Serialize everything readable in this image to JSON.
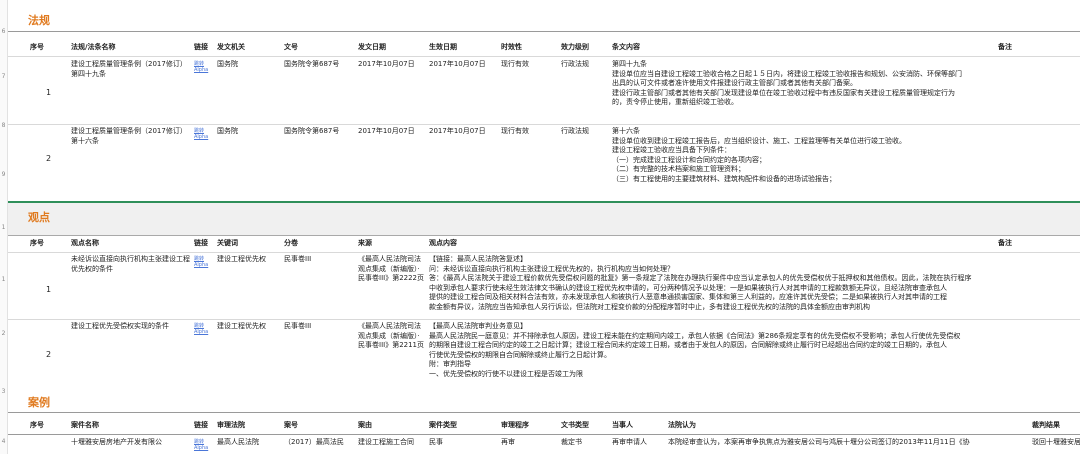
{
  "gutter_rows": [
    "6",
    "7",
    "8",
    "9",
    "1",
    "1",
    "2",
    "3",
    "4"
  ],
  "laws": {
    "title": "法规",
    "headers": {
      "no": "序号",
      "name": "法规/法条名称",
      "link": "链接",
      "org": "发文机关",
      "doc": "文号",
      "issue": "发文日期",
      "effective": "生效日期",
      "timeliness": "时效性",
      "level": "效力级别",
      "content": "条文内容",
      "remark": "备注"
    },
    "rows": [
      {
        "no": "1",
        "name": "建设工程质量管理条例（2017修订）第四十九条",
        "link": "跳转Alpha",
        "org": "国务院",
        "doc": "国务院令第687号",
        "issue": "2017年10月07日",
        "effective": "2017年10月07日",
        "timeliness": "现行有效",
        "level": "行政法规",
        "content": [
          "第四十九条",
          "建设单位应当自建设工程竣工验收合格之日起１５日内，将建设工程竣工验收报告和规划、公安消防、环保等部门",
          "出具的认可文件或者准许使用文件报建设行政主管部门或者其他有关部门备案。",
          "建设行政主管部门或者其他有关部门发现建设单位在竣工验收过程中有违反国家有关建设工程质量管理规定行为",
          "的，责令停止使用，重新组织竣工验收。"
        ]
      },
      {
        "no": "2",
        "name": "建设工程质量管理条例（2017修订）第十六条",
        "link": "跳转Alpha",
        "org": "国务院",
        "doc": "国务院令第687号",
        "issue": "2017年10月07日",
        "effective": "2017年10月07日",
        "timeliness": "现行有效",
        "level": "行政法规",
        "content": [
          "第十六条",
          "建设单位收到建设工程竣工报告后，应当组织设计、施工、工程监理等有关单位进行竣工验收。",
          "建设工程竣工验收应当具备下列条件：",
          "（一）完成建设工程设计和合同约定的各项内容；",
          "（二）有完整的技术档案和施工管理资料；",
          "（三）有工程使用的主要建筑材料、建筑构配件和设备的进场试验报告；"
        ]
      }
    ]
  },
  "views": {
    "title": "观点",
    "headers": {
      "no": "序号",
      "name": "观点名称",
      "link": "链接",
      "keyword": "关键词",
      "category": "分卷",
      "source": "来源",
      "content": "观点内容",
      "remark": "备注"
    },
    "rows": [
      {
        "no": "1",
        "name": "未经诉讼直接向执行机构主张建设工程优先权的条件",
        "link": "跳转Alpha",
        "keyword": "建设工程优先权",
        "category": "民事卷III",
        "source": "《最高人民法院司法观点集成（新编版）·民事卷III》第2222页",
        "content": [
          "【链接：最高人民法院答复述】",
          "问：未经诉讼直接向执行机构主张建设工程优先权的，执行机构应当如何处理？",
          "答：《最高人民法院关于建设工程价款优先受偿权问题的批复》第一条规定了法院在办理执行案件中应当认定承包人的优先受偿权优于抵押权和其他债权。因此，法院在执行程序",
          "中收到承包人要求行使未经生效法律文书确认的建设工程优先权申请的，可分两种情况予以处理：一是如果被执行人对其申请的工程款数额无异议，且经法院审查承包人",
          "提供的建设工程合同及相关材料合法有效，亦未发现承包人和被执行人恶意串通损害国家、集体和第三人利益的，应准许其优先受偿；二是如果被执行人对其申请的工程",
          "款金额有异议，法院应当告知承包人另行诉讼，但法院对工程变价款的分配程序暂时中止，多有建设工程优先权的法院的具体金额应由审判机构"
        ]
      },
      {
        "no": "2",
        "name": "建设工程优先受偿权实现的条件",
        "link": "跳转Alpha",
        "keyword": "建设工程优先权",
        "category": "民事卷III",
        "source": "《最高人民法院司法观点集成（新编版）·民事卷III》第2211页",
        "content": [
          "【最高人民法院审判业务意见】",
          "最高人民法院民一庭意见：并不排除承包人原因，建设工程未能在约定期间内竣工，承包人依据《合同法》第286条规定享有的优先受偿权不受影响；承包人行使优先受偿权",
          "的期限自建设工程合同约定的竣工之日起计算；建设工程合同未约定竣工日期，或者由于发包人的原因，合同解除或终止履行时已经超出合同约定的竣工日期的，承包人",
          "行使优先受偿权的期限自合同解除或终止履行之日起计算。",
          "附：审判指导",
          "一、优先受偿权的行使不以建设工程是否竣工为限"
        ]
      }
    ]
  },
  "cases": {
    "title": "案例",
    "headers": {
      "no": "序号",
      "name": "案件名称",
      "link": "链接",
      "court": "审理法院",
      "caseno": "案号",
      "cause": "案由",
      "casetype": "案件类型",
      "procedure": "审理程序",
      "doctype": "文书类型",
      "party": "当事人",
      "opinion": "法院认为",
      "result": "裁判结果"
    },
    "rows": [
      {
        "no": "1",
        "name": "十堰雅安居房地产开发有限公",
        "link": "跳转Alpha",
        "court": "最高人民法院",
        "caseno": "（2017）最高法民",
        "cause": "建设工程施工合同",
        "casetype": "民事",
        "procedure": "再审",
        "doctype": "裁定书",
        "party": "再审申请人",
        "opinion": "本院经审查认为，本案再审争执焦点为雅安居公司与鸿辰十堰分公司签订的2013年11月11日《协",
        "result": "驳回十堰雅安居房地产"
      }
    ]
  }
}
